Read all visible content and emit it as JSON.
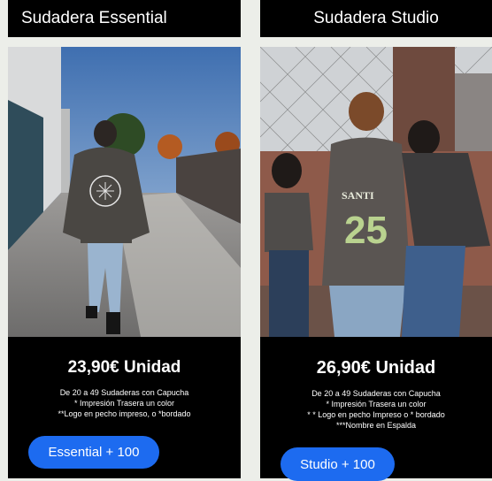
{
  "products": [
    {
      "title": "Sudadera Essential",
      "price": "23,90€ Unidad",
      "description": [
        "De 20 a 49 Sudaderas con Capucha",
        "* Impresión Trasera un color",
        "**Logo en pecho impreso, o *bordado"
      ],
      "button_label": "Essential + 100"
    },
    {
      "title": "Sudadera Studio",
      "price": "26,90€ Unidad",
      "description": [
        "De 20 a 49 Sudaderas con Capucha",
        "* Impresión Trasera un color",
        "* * Logo en pecho Impreso o * bordado",
        "***Nombre en Espalda"
      ],
      "button_label": "Studio + 100",
      "hoodie_print_name": "SANTI",
      "hoodie_print_number": "25"
    }
  ],
  "colors": {
    "button": "#1d6bf0",
    "panel": "#000000",
    "page": "#eceee9"
  }
}
